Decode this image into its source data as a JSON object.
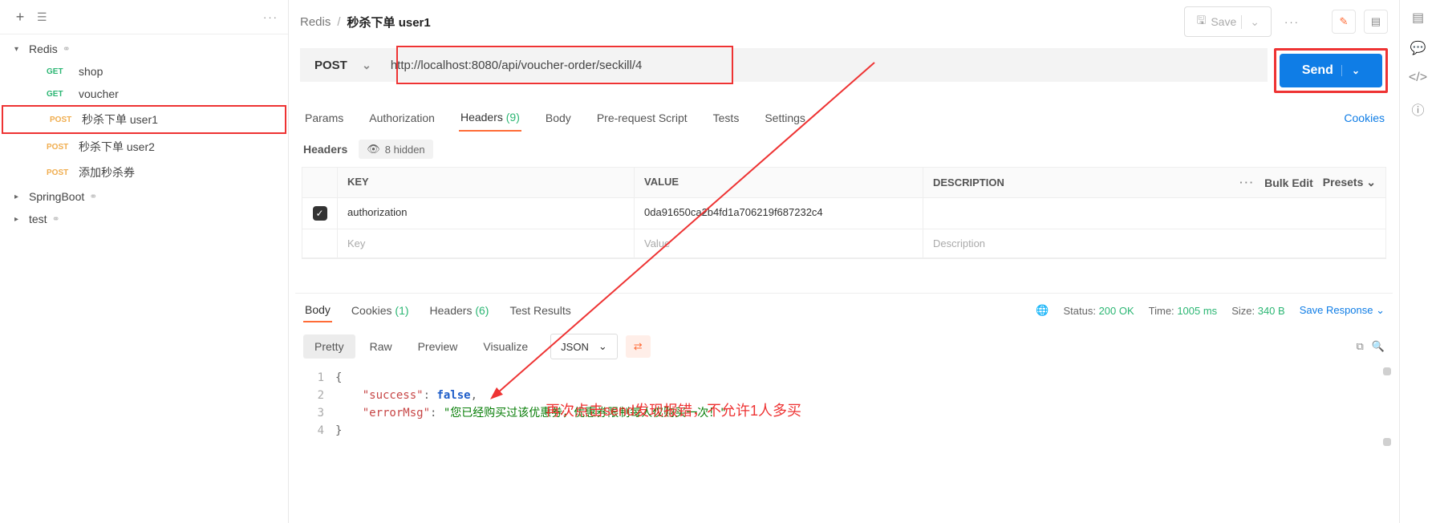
{
  "sidebar": {
    "folders": [
      {
        "name": "Redis",
        "expanded": true,
        "items": [
          {
            "method": "GET",
            "label": "shop"
          },
          {
            "method": "GET",
            "label": "voucher"
          },
          {
            "method": "POST",
            "label": "秒杀下单 user1",
            "selected": true
          },
          {
            "method": "POST",
            "label": "秒杀下单 user2"
          },
          {
            "method": "POST",
            "label": "添加秒杀券"
          }
        ]
      },
      {
        "name": "SpringBoot",
        "expanded": false,
        "items": []
      },
      {
        "name": "test",
        "expanded": false,
        "items": []
      }
    ]
  },
  "breadcrumb": {
    "parent": "Redis",
    "current": "秒杀下单 user1",
    "save_label": "Save"
  },
  "request": {
    "method": "POST",
    "url": "http://localhost:8080/api/voucher-order/seckill/4",
    "send_label": "Send"
  },
  "tabs": {
    "params": "Params",
    "auth": "Authorization",
    "headers": "Headers",
    "headers_count": "(9)",
    "body": "Body",
    "prereq": "Pre-request Script",
    "tests": "Tests",
    "settings": "Settings",
    "cookies": "Cookies"
  },
  "headers_section": {
    "title": "Headers",
    "hidden": "8 hidden",
    "columns": {
      "key": "KEY",
      "value": "VALUE",
      "desc": "DESCRIPTION"
    },
    "bulk": "Bulk Edit",
    "presets": "Presets",
    "rows": [
      {
        "key": "authorization",
        "value": "0da91650ca2b4fd1a706219f687232c4",
        "checked": true
      }
    ],
    "placeholder_key": "Key",
    "placeholder_value": "Value",
    "placeholder_desc": "Description"
  },
  "response": {
    "tabs": {
      "body": "Body",
      "cookies": "Cookies",
      "cookies_count": "(1)",
      "headers": "Headers",
      "headers_count": "(6)",
      "tests": "Test Results"
    },
    "status_label": "Status:",
    "status": "200 OK",
    "time_label": "Time:",
    "time": "1005 ms",
    "size_label": "Size:",
    "size": "340 B",
    "save_label": "Save Response",
    "view": {
      "pretty": "Pretty",
      "raw": "Raw",
      "preview": "Preview",
      "visualize": "Visualize",
      "format": "JSON"
    },
    "json_lines": [
      {
        "num": "1",
        "html": "{"
      },
      {
        "num": "2",
        "html": "    \"success\": false,"
      },
      {
        "num": "3",
        "html": "    \"errorMsg\": \"您已经购买过该优惠券，优惠券限制每人仅购买一次！\""
      },
      {
        "num": "4",
        "html": "}"
      }
    ]
  },
  "annotation": "再次点击send发现报错，不允许1人多买"
}
